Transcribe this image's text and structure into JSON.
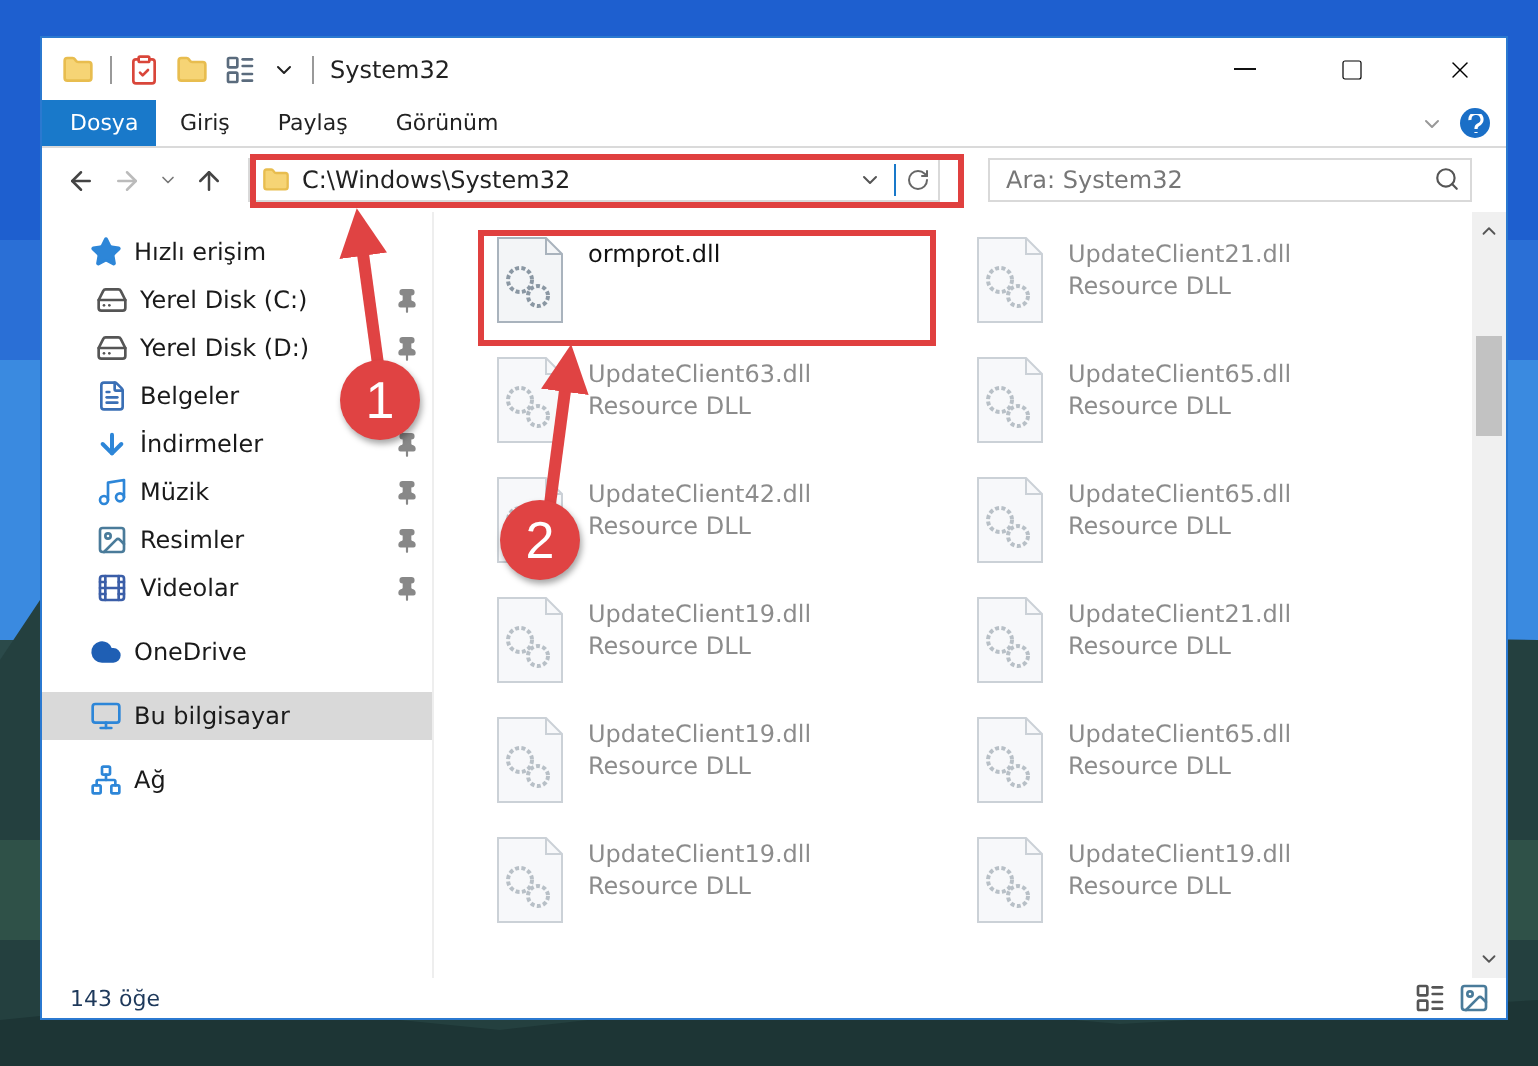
{
  "window": {
    "title": "System32"
  },
  "ribbon": {
    "tabs": [
      {
        "label": "Dosya",
        "selected": true
      },
      {
        "label": "Giriş",
        "selected": false
      },
      {
        "label": "Paylaş",
        "selected": false
      },
      {
        "label": "Görünüm",
        "selected": false
      }
    ]
  },
  "navigation": {
    "back": {
      "disabled": false
    },
    "forward": {
      "disabled": true
    }
  },
  "address": {
    "path": "C:\\Windows\\System32"
  },
  "search": {
    "placeholder": "Ara: System32"
  },
  "sidebar": {
    "items": [
      {
        "label": "Hızlı erişim",
        "selected": false,
        "children": [
          {
            "label": "Yerel Disk (C:)",
            "selected": false,
            "pinned": true
          },
          {
            "label": "Yerel Disk (D:)",
            "selected": false,
            "pinned": true
          },
          {
            "label": "Belgeler",
            "selected": false
          },
          {
            "label": "İndirmeler",
            "selected": false,
            "pinned": true
          },
          {
            "label": "Müzik",
            "selected": false,
            "pinned": true
          },
          {
            "label": "Resimler",
            "selected": false,
            "pinned": true
          },
          {
            "label": "Videolar",
            "selected": false,
            "pinned": true
          }
        ]
      },
      {
        "label": "OneDrive",
        "selected": false
      },
      {
        "label": "Bu bilgisayar",
        "selected": true
      },
      {
        "label": "Ağ",
        "selected": false
      }
    ]
  },
  "files": [
    {
      "name": "ormprot.dll",
      "blurred": false
    },
    {
      "name": "UpdateClient21.dll",
      "type": "Resource DLL",
      "blurred": true
    },
    {
      "name": "UpdateClient63.dll",
      "type": "Resource DLL",
      "blurred": true
    },
    {
      "name": "UpdateClient65.dll",
      "type": "Resource DLL",
      "blurred": true
    },
    {
      "name": "UpdateClient42.dll",
      "type": "Resource DLL",
      "blurred": true
    },
    {
      "name": "UpdateClient65.dll",
      "type": "Resource DLL",
      "blurred": true
    },
    {
      "name": "UpdateClient19.dll",
      "type": "Resource DLL",
      "blurred": true
    },
    {
      "name": "UpdateClient21.dll",
      "type": "Resource DLL",
      "blurred": true
    },
    {
      "name": "UpdateClient19.dll",
      "type": "Resource DLL",
      "blurred": true
    },
    {
      "name": "UpdateClient65.dll",
      "type": "Resource DLL",
      "blurred": true
    },
    {
      "name": "UpdateClient19.dll",
      "type": "Resource DLL",
      "blurred": true
    },
    {
      "name": "UpdateClient19.dll",
      "type": "Resource DLL",
      "blurred": true
    }
  ],
  "status_bar": {
    "item_count": "143 öğe"
  },
  "annotations": [
    {
      "number": "1"
    },
    {
      "number": "2"
    }
  ]
}
